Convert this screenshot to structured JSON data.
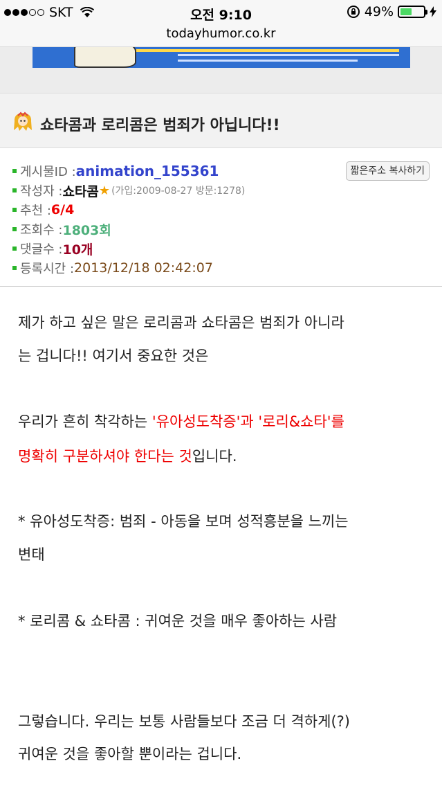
{
  "status_bar": {
    "carrier": "SKT",
    "time": "오전 9:10",
    "battery_percent": "49%",
    "battery_level": 0.49
  },
  "url_bar": {
    "url": "todayhumor.co.kr"
  },
  "post": {
    "title": "쇼타콤과 로리콤은 범죄가 아닙니다!!",
    "copy_button": "짧은주소 복사하기",
    "info": {
      "id_label": "게시물ID : ",
      "id_value": "animation_155361",
      "author_label": "작성자 : ",
      "author_value": "쇼타콤",
      "author_star": "★",
      "author_meta": "(가입:2009-08-27 방문:1278)",
      "recommend_label": "추천 : ",
      "recommend_value": "6/4",
      "views_label": "조회수 : ",
      "views_value": "1803회",
      "comments_label": "댓글수 : ",
      "comments_value": "10개",
      "date_label": "등록시간 : ",
      "date_value": "2013/12/18 02:42:07"
    },
    "body": {
      "p1_line1": "제가 하고 싶은 말은 로리콤과 쇼타콤은 범죄가 아니라",
      "p1_line2": "는 겁니다!! 여기서 중요한 것은",
      "p2_line1_a": "우리가 흔히 착각하는 ",
      "p2_line1_b": "'유아성도착증'과 '로리&쇼타'를",
      "p2_line2_a": "명확히 구분하셔야 한다는 것",
      "p2_line2_b": "입니다.",
      "p3_line1": " * 유아성도착증: 범죄 - 아동을 보며 성적흥분을 느끼는",
      "p3_line2": "변태",
      "p4_line1": " * 로리콤 & 쇼타콤 : 귀여운 것을 매우 좋아하는 사람",
      "p5_line1": "그렇습니다. 우리는 보통 사람들보다 조금 더 격하게(?)",
      "p5_line2": "귀여운 것을 좋아할 뿐이라는 겁니다."
    }
  }
}
